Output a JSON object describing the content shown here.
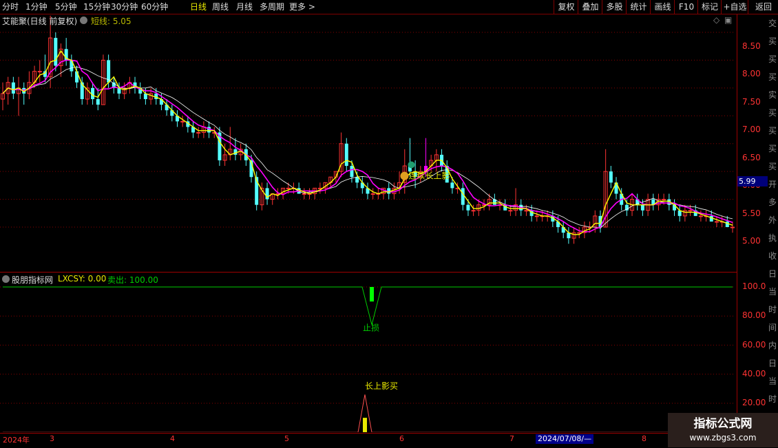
{
  "toolbar": {
    "periods": [
      "分时",
      "1分钟",
      "5分钟",
      "15分钟",
      "30分钟",
      "60分钟",
      "日线",
      "周线",
      "月线",
      "多周期",
      "更多"
    ],
    "active_period": "日线",
    "right_buttons": [
      "复权",
      "叠加",
      "多股",
      "统计",
      "画线",
      "F10",
      "标记",
      "+自选",
      "返回"
    ]
  },
  "main_panel": {
    "title": "艾能聚(日线 前复权)",
    "indicator_label": "短线: 5.05",
    "current_price_tag": "5.99",
    "y_ticks": [
      "8.50",
      "8.00",
      "7.50",
      "7.00",
      "6.50",
      "6.00",
      "5.50",
      "5.00"
    ],
    "annotations": [
      "连续长上影"
    ]
  },
  "sub_panel": {
    "title": "股朋指标网",
    "lxcsy_label": "LXCSY: 0.00",
    "sell_label": "卖出: 100.00",
    "y_ticks": [
      "100.0",
      "80.00",
      "60.00",
      "40.00",
      "20.00"
    ],
    "stop_loss_label": "止损",
    "long_shadow_buy_label": "长上影买"
  },
  "x_axis": {
    "labels": [
      "2024年",
      "3",
      "4",
      "5",
      "6",
      "7",
      "8"
    ],
    "cursor_date": "2024/07/08/—"
  },
  "right_strip_chars": [
    "交",
    "买",
    "买",
    "买",
    "实",
    "买",
    "买",
    "买",
    "买",
    "开",
    "多",
    "外",
    "执",
    "收",
    "日",
    "当",
    "时",
    "间",
    "内",
    "日",
    "当",
    "时",
    "间"
  ],
  "watermark": {
    "title": "指标公式网",
    "url": "www.zbgs3.com"
  },
  "colors": {
    "up": "#ff3333",
    "down": "#54ffff",
    "short_line": "#ffff00",
    "mid_line": "#ff00ff",
    "signal_line": "#00cc00",
    "accent_yellow": "#e8e800",
    "grid": "#8a0000"
  },
  "chart_data": {
    "type": "candlestick",
    "price_range": [
      4.6,
      8.9
    ],
    "ma_short_endpoint": 5.05,
    "candles": [
      [
        7.3,
        7.6,
        7.1,
        7.4
      ],
      [
        7.4,
        7.7,
        7.2,
        7.6
      ],
      [
        7.6,
        7.7,
        7.3,
        7.4
      ],
      [
        7.4,
        7.7,
        7.0,
        7.5
      ],
      [
        7.5,
        7.6,
        7.2,
        7.4
      ],
      [
        7.4,
        7.8,
        7.3,
        7.6
      ],
      [
        7.6,
        7.9,
        7.5,
        7.8
      ],
      [
        7.8,
        8.0,
        7.6,
        7.8
      ],
      [
        7.8,
        8.1,
        7.6,
        7.7
      ],
      [
        7.7,
        8.8,
        7.5,
        8.4
      ],
      [
        8.4,
        8.5,
        7.8,
        7.9
      ],
      [
        7.9,
        8.3,
        7.7,
        8.2
      ],
      [
        8.2,
        8.4,
        7.9,
        8.0
      ],
      [
        8.0,
        8.1,
        7.7,
        7.8
      ],
      [
        7.8,
        7.9,
        7.5,
        7.6
      ],
      [
        7.6,
        7.7,
        7.2,
        7.3
      ],
      [
        7.3,
        7.6,
        7.2,
        7.5
      ],
      [
        7.5,
        7.6,
        7.2,
        7.3
      ],
      [
        7.3,
        7.5,
        7.1,
        7.2
      ],
      [
        7.2,
        8.1,
        7.2,
        8.0
      ],
      [
        8.0,
        8.1,
        7.5,
        7.6
      ],
      [
        7.6,
        7.7,
        7.4,
        7.5
      ],
      [
        7.5,
        7.6,
        7.3,
        7.4
      ],
      [
        7.4,
        7.6,
        7.3,
        7.5
      ],
      [
        7.5,
        7.7,
        7.4,
        7.6
      ],
      [
        7.6,
        7.7,
        7.4,
        7.5
      ],
      [
        7.5,
        7.6,
        7.3,
        7.4
      ],
      [
        7.4,
        7.5,
        7.2,
        7.3
      ],
      [
        7.3,
        7.5,
        7.2,
        7.4
      ],
      [
        7.4,
        7.5,
        7.2,
        7.3
      ],
      [
        7.3,
        7.4,
        7.1,
        7.2
      ],
      [
        7.2,
        7.3,
        7.0,
        7.1
      ],
      [
        7.1,
        7.2,
        6.9,
        7.0
      ],
      [
        7.0,
        7.1,
        6.8,
        6.9
      ],
      [
        6.9,
        7.0,
        6.8,
        6.9
      ],
      [
        6.9,
        7.0,
        6.7,
        6.8
      ],
      [
        6.8,
        6.9,
        6.6,
        6.7
      ],
      [
        6.7,
        6.8,
        6.6,
        6.7
      ],
      [
        6.7,
        6.9,
        6.6,
        6.8
      ],
      [
        6.8,
        6.9,
        6.6,
        6.7
      ],
      [
        6.7,
        6.8,
        6.6,
        6.7
      ],
      [
        6.7,
        6.8,
        6.1,
        6.2
      ],
      [
        6.2,
        6.5,
        6.1,
        6.3
      ],
      [
        6.3,
        6.8,
        6.2,
        6.4
      ],
      [
        6.4,
        6.6,
        6.2,
        6.3
      ],
      [
        6.3,
        6.5,
        6.2,
        6.4
      ],
      [
        6.4,
        6.5,
        6.1,
        6.2
      ],
      [
        6.2,
        6.3,
        5.8,
        5.9
      ],
      [
        5.9,
        6.0,
        5.3,
        5.4
      ],
      [
        5.4,
        5.8,
        5.3,
        5.7
      ],
      [
        5.7,
        5.8,
        5.4,
        5.5
      ],
      [
        5.5,
        5.6,
        5.4,
        5.6
      ],
      [
        5.6,
        5.7,
        5.5,
        5.6
      ],
      [
        5.6,
        5.7,
        5.5,
        5.7
      ],
      [
        5.7,
        5.8,
        5.6,
        5.7
      ],
      [
        5.7,
        5.8,
        5.6,
        5.7
      ],
      [
        5.7,
        5.8,
        5.6,
        5.6
      ],
      [
        5.6,
        5.7,
        5.5,
        5.6
      ],
      [
        5.6,
        5.7,
        5.5,
        5.6
      ],
      [
        5.6,
        5.7,
        5.5,
        5.7
      ],
      [
        5.7,
        5.8,
        5.6,
        5.7
      ],
      [
        5.7,
        5.8,
        5.6,
        5.8
      ],
      [
        5.8,
        5.9,
        5.7,
        5.9
      ],
      [
        5.9,
        6.0,
        5.8,
        6.0
      ],
      [
        6.0,
        6.7,
        5.9,
        6.5
      ],
      [
        6.5,
        6.6,
        6.0,
        6.1
      ],
      [
        6.1,
        6.2,
        5.8,
        5.9
      ],
      [
        5.9,
        6.0,
        5.7,
        5.8
      ],
      [
        5.8,
        5.9,
        5.6,
        5.7
      ],
      [
        5.7,
        5.8,
        5.5,
        5.6
      ],
      [
        5.6,
        5.7,
        5.5,
        5.6
      ],
      [
        5.6,
        5.7,
        5.5,
        5.6
      ],
      [
        5.6,
        5.7,
        5.5,
        5.7
      ],
      [
        5.7,
        5.8,
        5.5,
        5.6
      ],
      [
        5.6,
        5.8,
        5.5,
        5.7
      ],
      [
        5.7,
        6.0,
        5.6,
        5.8
      ],
      [
        5.8,
        6.4,
        5.6,
        6.1
      ],
      [
        6.1,
        6.6,
        5.9,
        6.0
      ],
      [
        6.0,
        6.2,
        5.7,
        5.9
      ],
      [
        5.9,
        6.1,
        5.8,
        6.0
      ],
      [
        6.0,
        6.6,
        5.9,
        6.1
      ],
      [
        6.1,
        6.3,
        6.0,
        6.2
      ],
      [
        6.2,
        6.4,
        6.0,
        6.3
      ],
      [
        6.3,
        6.4,
        6.0,
        6.1
      ],
      [
        6.1,
        6.2,
        5.8,
        5.8
      ],
      [
        5.8,
        5.9,
        5.6,
        5.7
      ],
      [
        5.7,
        5.8,
        5.6,
        5.7
      ],
      [
        5.7,
        5.8,
        5.3,
        5.4
      ],
      [
        5.4,
        5.5,
        5.2,
        5.3
      ],
      [
        5.3,
        5.4,
        5.2,
        5.3
      ],
      [
        5.3,
        5.5,
        5.2,
        5.4
      ],
      [
        5.4,
        5.5,
        5.3,
        5.4
      ],
      [
        5.4,
        5.6,
        5.3,
        5.5
      ],
      [
        5.5,
        5.6,
        5.4,
        5.4
      ],
      [
        5.4,
        5.5,
        5.3,
        5.4
      ],
      [
        5.4,
        5.5,
        5.3,
        5.3
      ],
      [
        5.3,
        5.4,
        5.2,
        5.3
      ],
      [
        5.3,
        5.7,
        5.2,
        5.4
      ],
      [
        5.4,
        5.5,
        5.2,
        5.3
      ],
      [
        5.3,
        5.4,
        5.2,
        5.3
      ],
      [
        5.3,
        5.4,
        5.1,
        5.2
      ],
      [
        5.2,
        5.3,
        5.1,
        5.2
      ],
      [
        5.2,
        5.3,
        5.1,
        5.2
      ],
      [
        5.2,
        5.3,
        5.1,
        5.2
      ],
      [
        5.2,
        5.3,
        5.0,
        5.1
      ],
      [
        5.1,
        5.2,
        4.9,
        5.0
      ],
      [
        5.0,
        5.1,
        4.8,
        4.9
      ],
      [
        4.9,
        5.0,
        4.7,
        4.8
      ],
      [
        4.8,
        5.0,
        4.7,
        4.9
      ],
      [
        4.9,
        5.0,
        4.8,
        4.9
      ],
      [
        4.9,
        5.1,
        4.8,
        5.0
      ],
      [
        5.0,
        5.1,
        4.9,
        5.0
      ],
      [
        5.0,
        5.3,
        4.9,
        5.2
      ],
      [
        5.2,
        5.3,
        4.9,
        5.0
      ],
      [
        5.0,
        6.4,
        5.0,
        6.0
      ],
      [
        6.0,
        6.1,
        5.7,
        5.8
      ],
      [
        5.8,
        5.9,
        5.5,
        5.6
      ],
      [
        5.6,
        5.7,
        5.3,
        5.4
      ],
      [
        5.4,
        5.5,
        5.2,
        5.3
      ],
      [
        5.3,
        5.6,
        5.2,
        5.5
      ],
      [
        5.5,
        5.6,
        5.3,
        5.4
      ],
      [
        5.4,
        5.5,
        5.2,
        5.3
      ],
      [
        5.3,
        5.6,
        5.2,
        5.5
      ],
      [
        5.5,
        5.6,
        5.3,
        5.4
      ],
      [
        5.4,
        5.6,
        5.3,
        5.5
      ],
      [
        5.5,
        5.6,
        5.4,
        5.5
      ],
      [
        5.5,
        5.6,
        5.3,
        5.4
      ],
      [
        5.4,
        5.5,
        5.2,
        5.3
      ],
      [
        5.3,
        5.4,
        5.1,
        5.2
      ],
      [
        5.2,
        5.4,
        5.1,
        5.3
      ],
      [
        5.3,
        5.4,
        5.2,
        5.3
      ],
      [
        5.3,
        5.4,
        5.2,
        5.2
      ],
      [
        5.2,
        5.3,
        5.1,
        5.2
      ],
      [
        5.2,
        5.3,
        5.1,
        5.2
      ],
      [
        5.2,
        5.3,
        5.1,
        5.1
      ],
      [
        5.1,
        5.2,
        5.0,
        5.1
      ],
      [
        5.1,
        5.2,
        5.0,
        5.1
      ],
      [
        5.1,
        5.2,
        5.0,
        5.0
      ],
      [
        5.0,
        5.1,
        4.9,
        5.0
      ]
    ]
  }
}
